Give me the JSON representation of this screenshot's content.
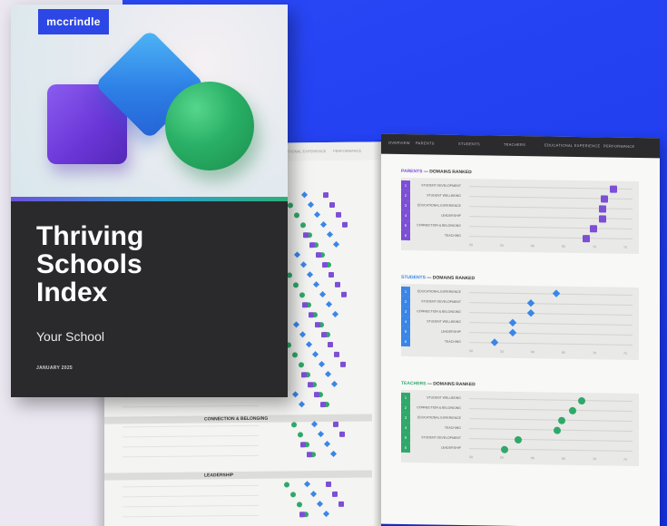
{
  "brand": {
    "logo_text": "mccrindle"
  },
  "cover": {
    "title_lines": [
      "Thriving",
      "Schools",
      "Index"
    ],
    "school": "Your School",
    "date": "JANUARY 2025"
  },
  "left_page": {
    "tabs": [
      "EMOTIONAL EXPERIENCE",
      "PERFORMANCE"
    ],
    "sections": [
      "CONNECTION & BELONGING",
      "LEADERSHIP"
    ]
  },
  "right_page": {
    "tabs": [
      "OVERVIEW",
      "PARENTS",
      "STUDENTS",
      "TEACHERS",
      "EDUCATIONAL EXPERIENCE",
      "PERFORMANCE"
    ],
    "charts": [
      {
        "group": "PARENTS",
        "heading_rest": " — DOMAINS RANKED",
        "accent": "#7c4fd6",
        "rows": [
          "STUDENT DEVELOPMENT",
          "STUDENT WELLBEING",
          "EDUCATIONAL EXPERIENCE",
          "LEADERSHIP",
          "CONNECTION & BELONGING",
          "TEACHING"
        ],
        "ticks": [
          "50",
          "55",
          "60",
          "65",
          "70",
          "75"
        ]
      },
      {
        "group": "STUDENTS",
        "heading_rest": " — DOMAINS RANKED",
        "accent": "#3a86e8",
        "rows": [
          "EDUCATIONAL EXPERIENCE",
          "STUDENT DEVELOPMENT",
          "CONNECTION & BELONGING",
          "STUDENT WELLBEING",
          "LEADERSHIP",
          "TEACHING"
        ],
        "ticks": [
          "50",
          "55",
          "60",
          "65",
          "70",
          "75"
        ]
      },
      {
        "group": "TEACHERS",
        "heading_rest": " — DOMAINS RANKED",
        "accent": "#2fa86a",
        "rows": [
          "STUDENT WELLBEING",
          "CONNECTION & BELONGING",
          "EDUCATIONAL EXPERIENCE",
          "TEACHING",
          "STUDENT DEVELOPMENT",
          "LEADERSHIP"
        ],
        "ticks": [
          "50",
          "55",
          "60",
          "65",
          "70",
          "75"
        ]
      }
    ]
  },
  "colors": {
    "blue_bg": "#1f3cf0",
    "purple": "#7c4fd6",
    "blue": "#3a86e8",
    "green": "#2fa86a",
    "cover_dark": "#2a2a2c"
  }
}
